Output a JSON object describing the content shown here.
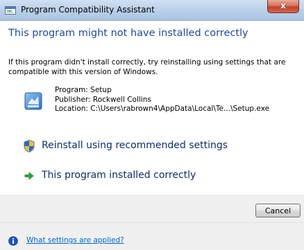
{
  "window": {
    "title": "Program Compatibility Assistant",
    "close_label": "x"
  },
  "main": {
    "heading": "This program might not have installed correctly",
    "description": "If this program didn't install correctly, try reinstalling using settings that are compatible with this version of Windows.",
    "program_info": {
      "program": "Program: Setup",
      "publisher": "Publisher: Rockwell Collins",
      "location": "Location: C:\\Users\\rabrown4\\AppData\\Local\\Te...\\Setup.exe"
    }
  },
  "commands": [
    {
      "label": "Reinstall using recommended settings",
      "icon": "uac-shield-icon"
    },
    {
      "label": "This program installed correctly",
      "icon": "green-arrow-icon"
    }
  ],
  "buttons": {
    "cancel_label": "Cancel"
  },
  "footer": {
    "link_label": "What settings are applied?",
    "icon": "info-icon"
  },
  "colors": {
    "heading": "#1c4a9e",
    "command_text": "#0b2f6b",
    "link": "#0066cc",
    "close_button": "#c4412a",
    "strip_background": "#f0f0f0"
  }
}
